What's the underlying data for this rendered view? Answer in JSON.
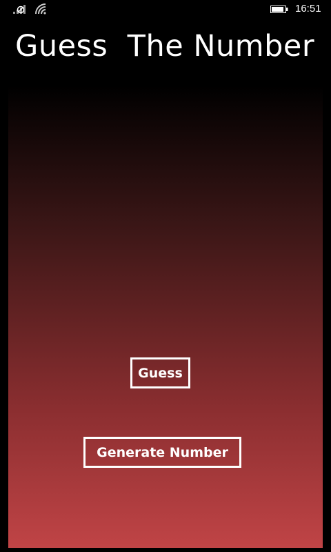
{
  "status_bar": {
    "signal_icon": "signal-strength-icon",
    "wifi_icon": "wifi-icon",
    "battery_icon": "battery-icon",
    "time": "16:51"
  },
  "app": {
    "title": "Guess  The Number"
  },
  "buttons": {
    "guess_label": "Guess",
    "generate_label": "Generate Number"
  },
  "colors": {
    "background": "#000000",
    "gradient_top": "#000000",
    "gradient_bottom": "#c04446",
    "text": "#ffffff"
  }
}
